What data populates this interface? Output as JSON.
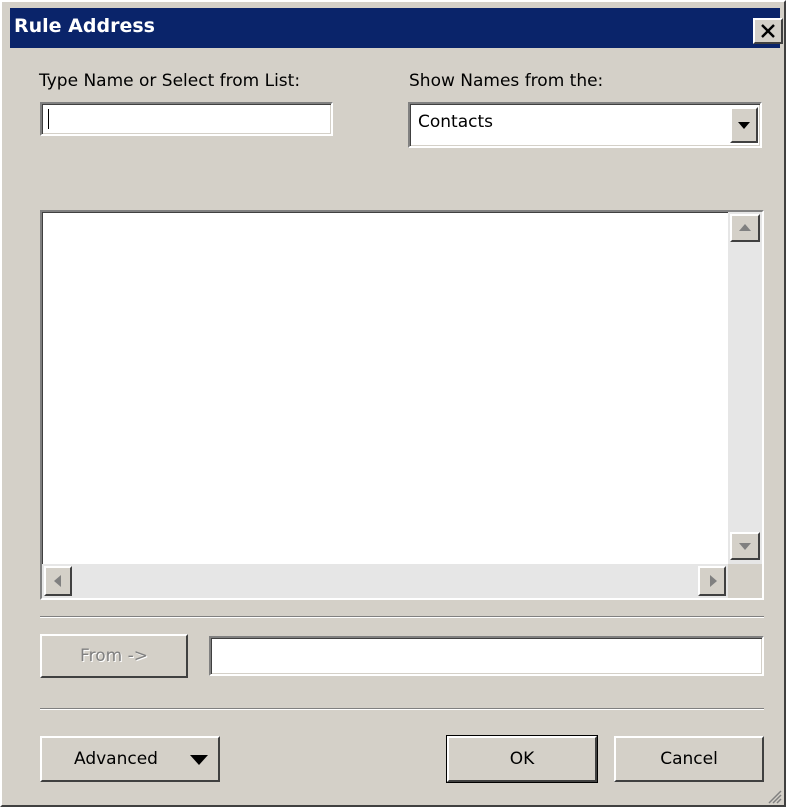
{
  "window": {
    "title": "Rule Address",
    "close_icon": "close-icon"
  },
  "name_input": {
    "label": "Type Name or Select from List:",
    "value": ""
  },
  "source_select": {
    "label": "Show Names from the:",
    "selected": "Contacts"
  },
  "recipient_row": {
    "from_button_label": "From ->",
    "from_value": ""
  },
  "footer": {
    "advanced_label": "Advanced",
    "ok_label": "OK",
    "cancel_label": "Cancel"
  },
  "colors": {
    "titlebar": "#0a246a",
    "dialog_face": "#d4d0c8"
  }
}
